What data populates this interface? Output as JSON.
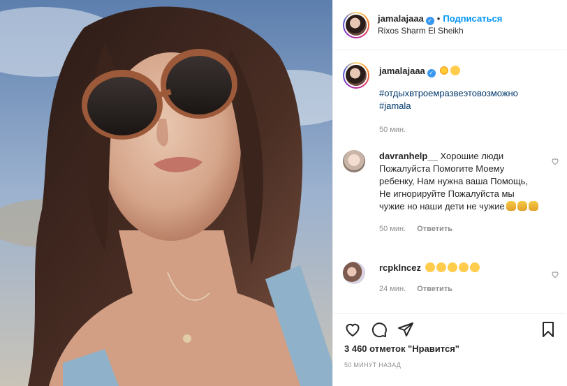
{
  "post": {
    "username": "jamalajaaa",
    "follow_label": "Подписаться",
    "dot": "•",
    "location": "Rixos Sharm El Sheikh"
  },
  "caption": {
    "username": "jamalajaaa",
    "emojis": [
      "sun-emoji",
      "kiss-emoji"
    ],
    "hashtag1": "#отдыхвтроемразвеэтовозможно",
    "hashtag2": "#jamala",
    "time": "50 мин."
  },
  "comments": [
    {
      "username": "davranhelp__",
      "text": "Хорошие люди Пожалуйста Помогите Моему ребенку, Нам нужна ваша Помощь, Не игнорируйте Пожалуйста мы чужие но наши дети не чужие",
      "emojis": [
        "folded-hands-emoji",
        "folded-hands-emoji",
        "folded-hands-emoji"
      ],
      "time": "50 мин.",
      "reply_label": "Ответить"
    },
    {
      "username": "rcpklncez",
      "text": "",
      "emojis": [
        "star-struck-emoji",
        "star-struck-emoji",
        "star-struck-emoji",
        "star-struck-emoji",
        "star-struck-emoji"
      ],
      "time": "24 мин.",
      "reply_label": "Ответить"
    }
  ],
  "footer": {
    "likes": "3 460 отметок \"Нравится\"",
    "timestamp": "50 МИНУТ НАЗАД"
  },
  "colors": {
    "link": "#0095f6",
    "hashtag": "#00376b",
    "muted": "#8e8e8e",
    "verified": "#3897f0"
  }
}
